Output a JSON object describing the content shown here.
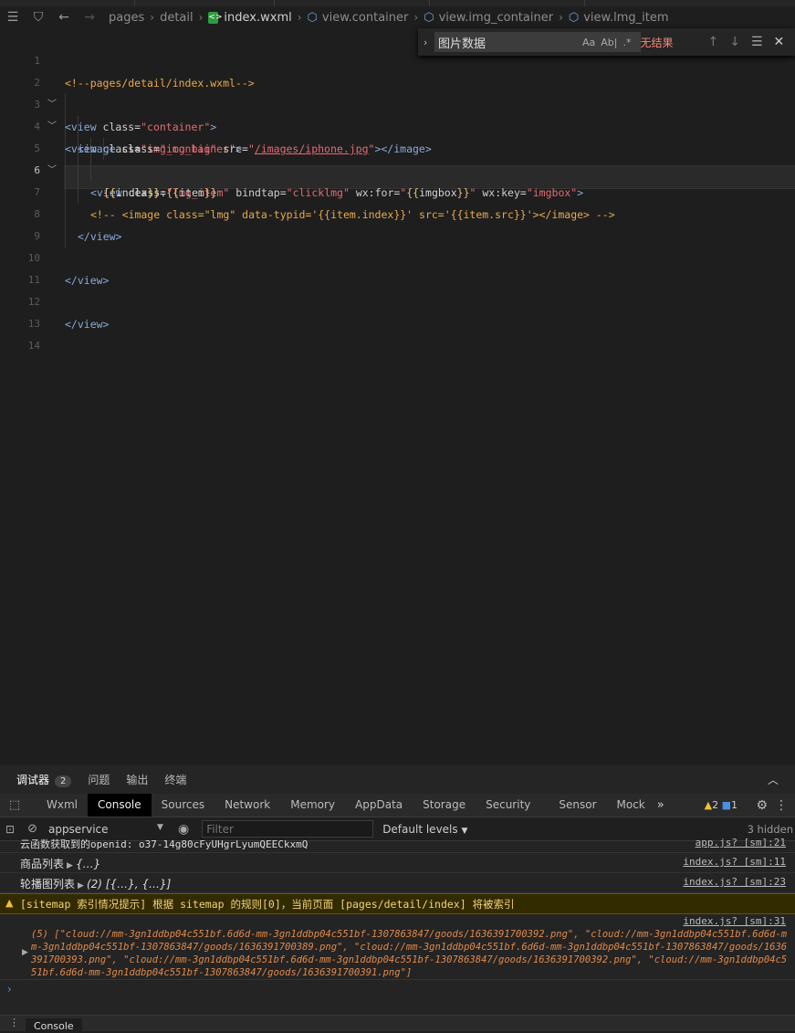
{
  "breadcrumb": {
    "items": [
      "pages",
      "detail"
    ],
    "file": "index.wxml",
    "symbols": [
      "view.container",
      "view.img_container",
      "view.lmg_item"
    ]
  },
  "find": {
    "query": "图片数据",
    "options": [
      "Aa",
      "Ab|",
      ".*"
    ],
    "result": "无结果"
  },
  "editor": {
    "lines": [
      {
        "n": "1"
      },
      {
        "n": "2"
      },
      {
        "n": "3"
      },
      {
        "n": "4"
      },
      {
        "n": "5"
      },
      {
        "n": "6"
      },
      {
        "n": "7"
      },
      {
        "n": "8"
      },
      {
        "n": "9"
      },
      {
        "n": "10"
      },
      {
        "n": "11"
      },
      {
        "n": "12"
      },
      {
        "n": "13"
      },
      {
        "n": "14"
      }
    ],
    "code": {
      "l1": "<!--pages/detail/index.wxml-->",
      "l2_tag": "<view",
      "l2_attr": " class=",
      "l2_val": "\"container\"",
      "l2_end": ">",
      "l3_tag": "<view",
      "l3_attr": " class=",
      "l3_val": "\"img_container\"",
      "l3_end": ">",
      "l4_tag": "<image",
      "l4_attr1": " class=",
      "l4_val1": "\"img_big\"",
      "l4_attr2": " src=",
      "l4_q1": "\"",
      "l4_link": "/images/iphone.jpg",
      "l4_q2": "\"",
      "l4_end": "></image>",
      "l5_tag": "<view",
      "l5_attr1": " class=",
      "l5_val1": "\"lmg_item\"",
      "l5_attr2": " bindtap=",
      "l5_val2": "\"clicklmg\"",
      "l5_attr3": " wx:for=",
      "l5_q1": "\"",
      "l5_b1": "{{",
      "l5_v3": "imgbox",
      "l5_b2": "}}",
      "l5_q2": "\"",
      "l5_attr4": " wx:key=",
      "l5_val4": "\"imgbox\"",
      "l5_end": ">",
      "l6_b1": "{{",
      "l6_v1": "index",
      "l6_b2": "}}",
      "l6_colon": ":",
      "l6_b3": "{{",
      "l6_v2": "item",
      "l6_b4": "}}",
      "l7": "<!-- <image class=\"lmg\" data-typid='{{item.index}}' src='{{item.src}}'></image> -->",
      "l8": "</view>",
      "l10": "</view>",
      "l12": "</view>"
    }
  },
  "panel": {
    "tabs": [
      {
        "label": "调试器",
        "badge": "2"
      },
      {
        "label": "问题"
      },
      {
        "label": "输出"
      },
      {
        "label": "终端"
      }
    ]
  },
  "devtools": {
    "tabs": [
      "Wxml",
      "Console",
      "Sources",
      "Network",
      "Memory",
      "AppData",
      "Storage",
      "Security",
      "Sensor",
      "Mock"
    ],
    "warn_count": "2",
    "info_count": "1"
  },
  "toolbar": {
    "context": "appservice",
    "filter_placeholder": "Filter",
    "levels": "Default levels",
    "hidden": "3 hidden"
  },
  "console": {
    "m1_text": "云函数获取到的openid: o37-14g80cFyUHgrLyumQEECkxmQ",
    "m1_src": "app.js? [sm]:21",
    "m2_label": "商品列表",
    "m2_obj": "{…}",
    "m2_src": "index.js? [sm]:11",
    "m3_label": "轮播图列表",
    "m3_obj": "(2) [{…}, {…}]",
    "m3_src": "index.js? [sm]:23",
    "m4_text": "[sitemap 索引情况提示] 根据 sitemap 的规则[0]，当前页面 [pages/detail/index] 将被索引",
    "m5_src": "index.js? [sm]:31",
    "m5_text": "(5) [\"cloud://mm-3gn1ddbp04c551bf.6d6d-mm-3gn1ddbp04c551bf-1307863847/goods/1636391700392.png\", \"cloud://mm-3gn1ddbp04c551bf.6d6d-mm-3gn1ddbp04c551bf-1307863847/goods/1636391700389.png\", \"cloud://mm-3gn1ddbp04c551bf.6d6d-mm-3gn1ddbp04c551bf-1307863847/goods/1636391700393.png\", \"cloud://mm-3gn1ddbp04c551bf.6d6d-mm-3gn1ddbp04c551bf-1307863847/goods/1636391700392.png\", \"cloud://mm-3gn1ddbp04c551bf.6d6d-mm-3gn1ddbp04c551bf-1307863847/goods/1636391700391.png\"]"
  },
  "drawer": {
    "tab": "Console"
  }
}
